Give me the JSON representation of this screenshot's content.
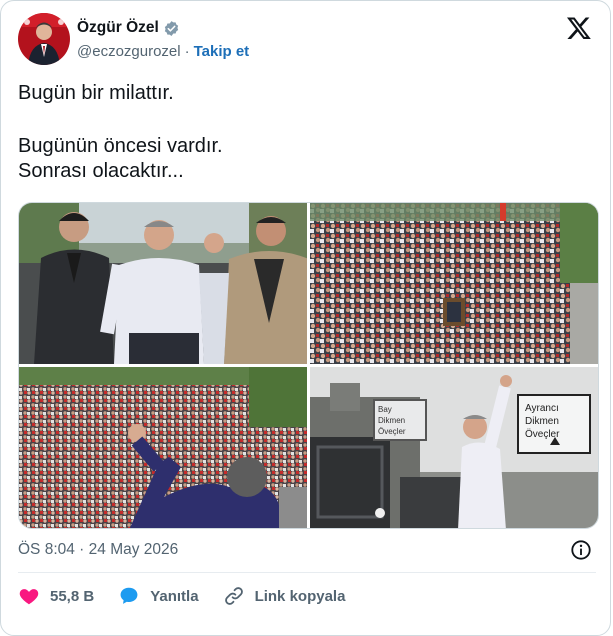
{
  "tweet": {
    "author_name": "Özgür Özel",
    "handle": "@eczozgurozel",
    "separator": "·",
    "follow_label": "Takip et",
    "text_lines": [
      "Bugün bir milattır.",
      "Bugünün öncesi vardır.",
      "Sonrası olacaktır..."
    ],
    "timestamp": "ÖS 8:04 · 24 May 2026"
  },
  "actions": {
    "like_count": "55,8 B",
    "reply_label": "Yanıtla",
    "copy_link_label": "Link kopyala"
  },
  "media": {
    "sign_line1": "Ayrancı",
    "sign_line2": "Dikmen",
    "sign_line3": "Öveçler",
    "sign_left1": "Bay",
    "sign_left2": "Dikmen",
    "sign_left3": "Öveçler"
  },
  "colors": {
    "accent": "#1d9bf0",
    "like": "#f91880",
    "muted": "#536471",
    "follow": "#1d6fb8"
  },
  "icons": {
    "logo": "x-logo-icon",
    "verified": "verified-badge-icon",
    "info": "info-icon",
    "like": "heart-icon",
    "reply": "speech-bubble-icon",
    "link": "link-icon"
  }
}
